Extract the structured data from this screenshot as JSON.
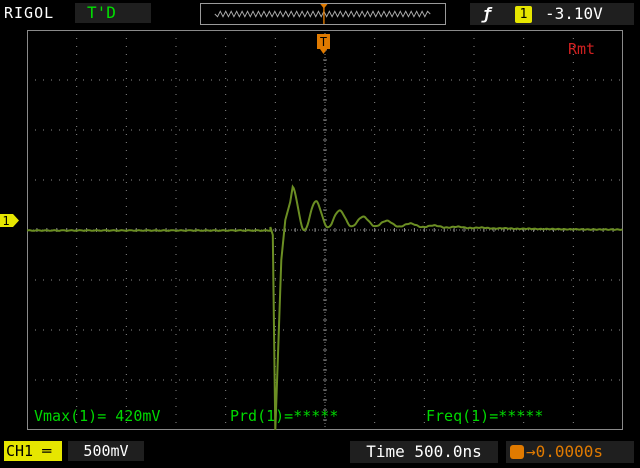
{
  "header": {
    "brand": "RIGOL",
    "trigger_status": "T'D",
    "trigger_edge_icon": "rising-edge-icon",
    "trigger_source": "1",
    "trigger_level": "-3.10V"
  },
  "screen": {
    "remote_indicator": "Rmt",
    "trigger_marker_label": "T",
    "channel_marker_label": "1"
  },
  "measurements": {
    "vmax": "Vmax(1)= 420mV",
    "period": "Prd(1)=*****",
    "frequency": "Freq(1)=*****"
  },
  "footer": {
    "channel_label": "CH1",
    "channel_scale": "500mV",
    "timebase": "Time 500.0ns",
    "trigger_offset": "→0.0000s"
  },
  "colors": {
    "background": "#000000",
    "trace": "#6b8e23",
    "grid": "#8a8a8a",
    "channel": "#e6e600",
    "trigger": "#e07a00",
    "measurements": "#00d800",
    "remote": "#d02020"
  }
}
